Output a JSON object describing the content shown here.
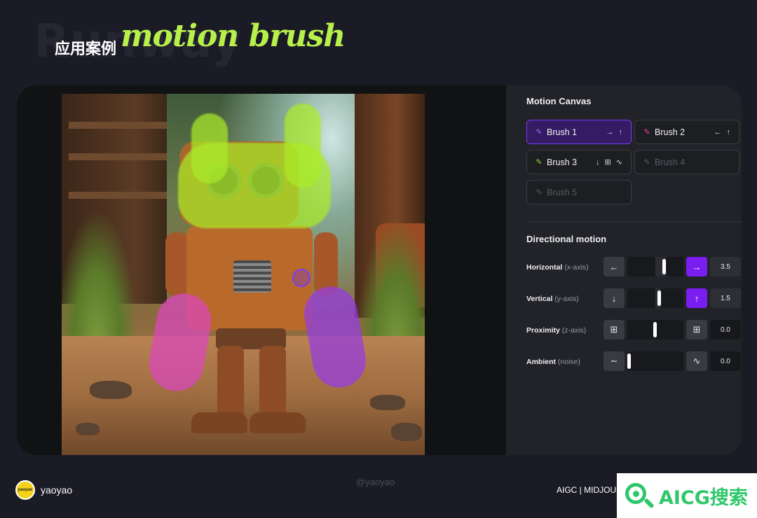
{
  "header": {
    "background_title": "Runway",
    "title_cn": "应用案例",
    "title_accent": "motion brush"
  },
  "panel": {
    "motion_canvas_title": "Motion Canvas",
    "brushes": [
      {
        "label": "Brush 1",
        "arrows": "→ ↑",
        "color": "#7a3bf0",
        "state": "active"
      },
      {
        "label": "Brush 2",
        "arrows": "← ↑",
        "color": "#e040a0",
        "state": "normal"
      },
      {
        "label": "Brush 3",
        "arrows": "↓ ⊞ ∿",
        "color": "#8fd33a",
        "state": "normal"
      },
      {
        "label": "Brush 4",
        "arrows": "",
        "color": "#585a63",
        "state": "disabled"
      },
      {
        "label": "Brush 5",
        "arrows": "",
        "color": "#585a63",
        "state": "disabled"
      }
    ],
    "directional_title": "Directional motion",
    "controls": [
      {
        "label": "Horizontal",
        "sub": "(x-axis)",
        "left_icon": "←",
        "right_icon": "→",
        "value": "3.5",
        "level": 0.67,
        "right_active": true
      },
      {
        "label": "Vertical",
        "sub": "(y-axis)",
        "left_icon": "↓",
        "right_icon": "↑",
        "value": "1.5",
        "level": 0.57,
        "right_active": true
      },
      {
        "label": "Proximity",
        "sub": "(z-axis)",
        "left_icon": "⊞",
        "right_icon": "⊞",
        "value": "0.0",
        "level": 0.5,
        "right_active": false
      },
      {
        "label": "Ambient",
        "sub": "(noise)",
        "left_icon": "∼",
        "right_icon": "∿",
        "value": "0.0",
        "level": 0.0,
        "right_active": false
      }
    ]
  },
  "footer": {
    "avatar_text": "yaoyao",
    "author": "yaoyao",
    "watermark": "@yaoyao",
    "right_text": "AIGC | MIDJOUR",
    "logo_text": "AICG搜索"
  },
  "colors": {
    "accent_green": "#b7f04a",
    "accent_purple": "#7a1df0",
    "logo_green": "#2fc76b"
  }
}
